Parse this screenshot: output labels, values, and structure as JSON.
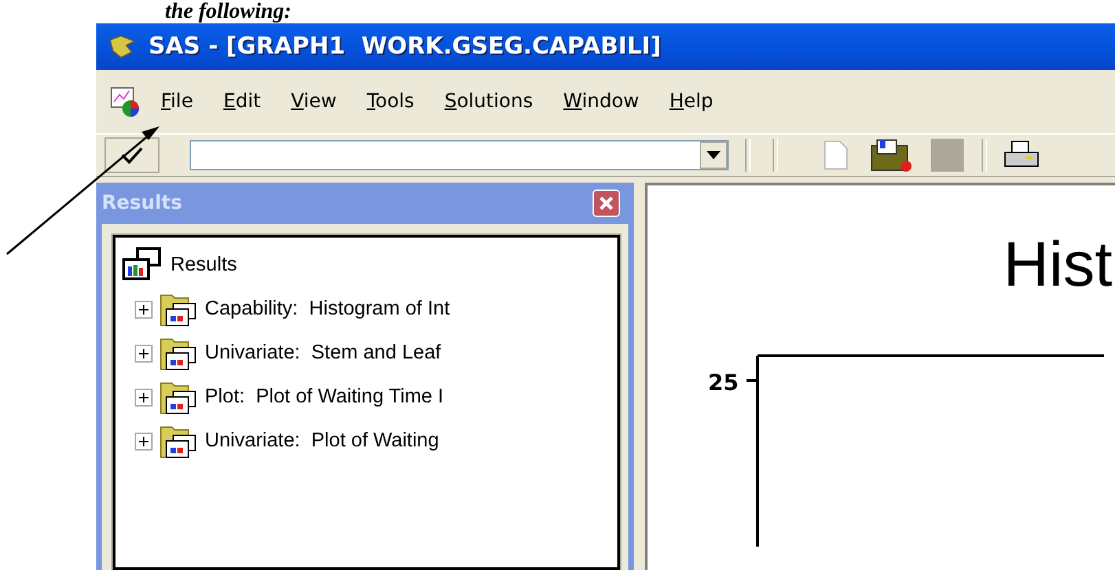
{
  "caption": "the following:",
  "window": {
    "title": "SAS - [GRAPH1  WORK.GSEG.CAPABILI]"
  },
  "menu": [
    "File",
    "Edit",
    "View",
    "Tools",
    "Solutions",
    "Window",
    "Help"
  ],
  "results_panel": {
    "title": "Results",
    "tree": {
      "label": "Results",
      "children": [
        {
          "label": "Capability:  Histogram of Int",
          "expanded": false
        },
        {
          "label": "Univariate:  Stem and Leaf",
          "expanded": false
        },
        {
          "label": "Plot:  Plot of Waiting Time I",
          "expanded": false
        },
        {
          "label": "Univariate:  Plot of Waiting",
          "expanded": false
        }
      ]
    }
  },
  "graph": {
    "title": "Hist",
    "y_tick": "25"
  }
}
